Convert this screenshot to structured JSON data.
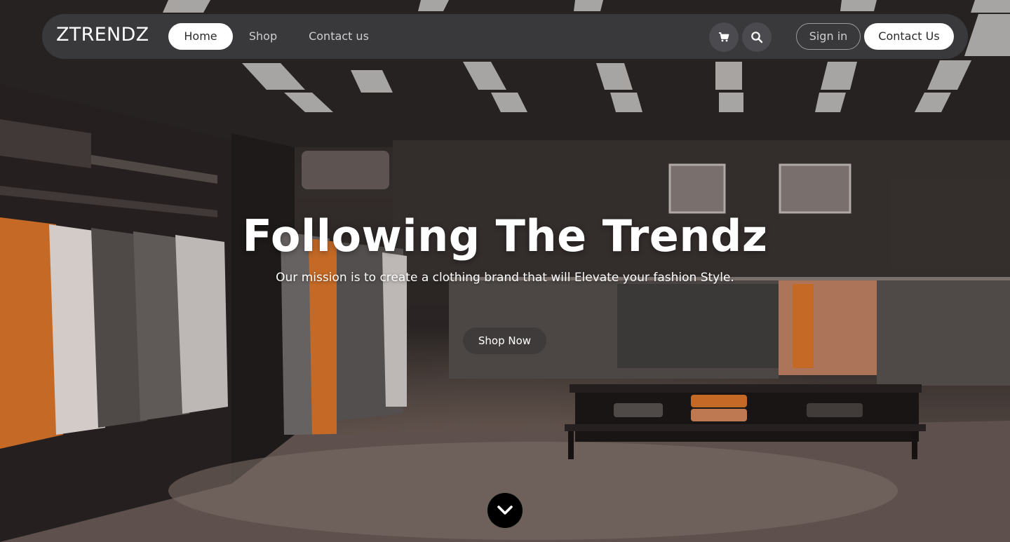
{
  "brand": {
    "logo_text": "ZTRENDZ"
  },
  "nav": {
    "links": [
      {
        "label": "Home",
        "active": true
      },
      {
        "label": "Shop",
        "active": false
      },
      {
        "label": "Contact us",
        "active": false
      }
    ],
    "icons": [
      "cart-icon",
      "search-icon"
    ],
    "signin_label": "Sign in",
    "contact_label": "Contact Us"
  },
  "hero": {
    "headline": "Following The Trendz",
    "subtitle": "Our mission is to create a clothing brand that will Elevate your fashion Style.",
    "cta_label": "Shop Now",
    "scroll_icon": "chevron-down-icon"
  },
  "colors": {
    "navbar_bg": "#3a393c",
    "active_pill": "#ffffff",
    "cta_bg": "#3f3b3a",
    "accent_orange": "#e0782c"
  }
}
